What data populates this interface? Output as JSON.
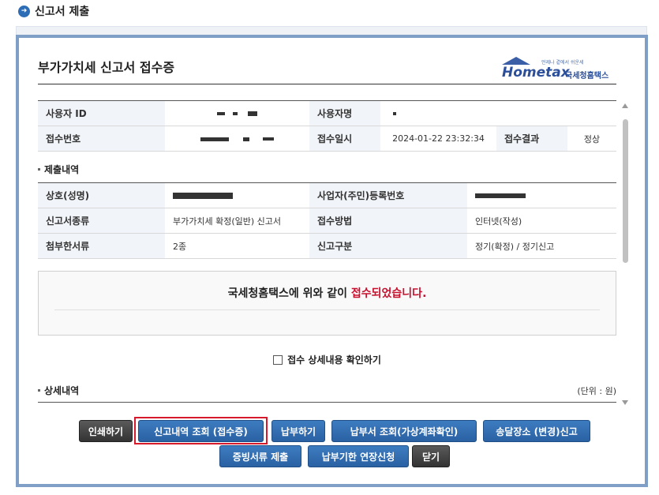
{
  "page": {
    "title": "신고서 제출",
    "icon": "arrow-right-circle-icon"
  },
  "doc": {
    "title": "부가가치세 신고서 접수증",
    "logo": {
      "brand": "Hometax",
      "brand_kr": "국세청홈택스",
      "small": "언제나 곁에서 쉬운세"
    }
  },
  "info_table": {
    "user_id_label": "사용자 ID",
    "user_name_label": "사용자명",
    "receipt_no_label": "접수번호",
    "receipt_time_label": "접수일시",
    "receipt_time_value": "2024-01-22 23:32:34",
    "receipt_result_label": "접수결과",
    "receipt_result_value": "정상"
  },
  "submission": {
    "section_title": "제출내역",
    "company_label": "상호(성명)",
    "biz_no_label": "사업자(주민)등록번호",
    "form_type_label": "신고서종류",
    "form_type_value": "부가가치세 확정(일반) 신고서",
    "method_label": "접수방법",
    "method_value": "인터넷(작성)",
    "attach_label": "첨부한서류",
    "attach_value": "2종",
    "category_label": "신고구분",
    "category_value": "정기(확정) / 정기신고"
  },
  "message": {
    "prefix": "국세청홈택스에 위와 같이 ",
    "highlight": "접수되었습니다."
  },
  "detail_check": {
    "label": "접수 상세내용 확인하기"
  },
  "detail": {
    "section_title": "상세내역",
    "unit": "(단위 : 원)"
  },
  "buttons": {
    "print": "인쇄하기",
    "lookup": "신고내역 조회 (접수증)",
    "pay": "납부하기",
    "payment_slip": "납부서 조회(가상계좌확인)",
    "delivery": "송달장소 (변경)신고",
    "evidence": "증빙서류 제출",
    "extension": "납부기한 연장신청",
    "close": "닫기"
  },
  "colors": {
    "accent": "#2a62a3",
    "frame": "#7f9fc6",
    "alert_red": "#c8102e",
    "highlight_red": "#d7192c"
  }
}
